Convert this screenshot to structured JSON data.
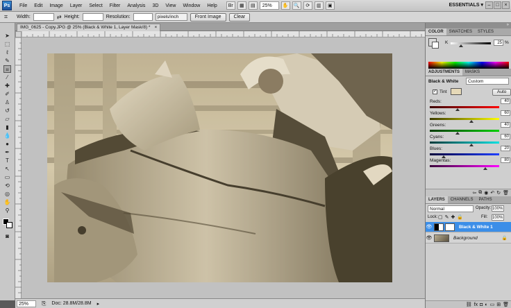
{
  "app": {
    "logo": "Ps"
  },
  "menu": [
    "File",
    "Edit",
    "Image",
    "Layer",
    "Select",
    "Filter",
    "Analysis",
    "3D",
    "View",
    "Window",
    "Help"
  ],
  "menubar": {
    "zoom": "25%",
    "workspace": "ESSENTIALS ▾",
    "window_buttons": [
      "–",
      "□",
      "×"
    ]
  },
  "options": {
    "width_label": "Width:",
    "height_label": "Height:",
    "resolution_label": "Resolution:",
    "unit": "pixels/inch",
    "front_image": "Front Image",
    "clear": "Clear"
  },
  "document": {
    "tab_title": "IMG_0625 - Copy.JPG @ 25% (Black & White 1, Layer Mask/8) *",
    "close": "×"
  },
  "status": {
    "zoom": "25%",
    "doc": "Doc: 28.8M/28.8M"
  },
  "color_panel": {
    "tabs": [
      "COLOR",
      "SWATCHES",
      "STYLES"
    ],
    "k_label": "K",
    "k_value": "25",
    "k_unit": "%",
    "k_fraction": 0.25
  },
  "adjustments": {
    "tabs": [
      "ADJUSTMENTS",
      "MASKS"
    ],
    "title": "Black & White",
    "preset": "Custom",
    "tint_label": "Tint",
    "auto": "Auto",
    "sliders": [
      {
        "label": "Reds:",
        "value": "40",
        "pct": 0.4,
        "colors": [
          "#3a0000",
          "#ff0000"
        ]
      },
      {
        "label": "Yellows:",
        "value": "60",
        "pct": 0.6,
        "colors": [
          "#3a3a00",
          "#ffff00"
        ]
      },
      {
        "label": "Greens:",
        "value": "40",
        "pct": 0.4,
        "colors": [
          "#003a00",
          "#00d000"
        ]
      },
      {
        "label": "Cyans:",
        "value": "60",
        "pct": 0.6,
        "colors": [
          "#003a3a",
          "#00e0e0"
        ]
      },
      {
        "label": "Blues:",
        "value": "20",
        "pct": 0.2,
        "colors": [
          "#00003a",
          "#2040ff"
        ]
      },
      {
        "label": "Magentas:",
        "value": "80",
        "pct": 0.8,
        "colors": [
          "#3a003a",
          "#ff00ff"
        ]
      }
    ]
  },
  "layers": {
    "tabs": [
      "LAYERS",
      "CHANNELS",
      "PATHS"
    ],
    "blend_mode": "Normal",
    "opacity_label": "Opacity:",
    "opacity": "100%",
    "lock_label": "Lock:",
    "fill_label": "Fill:",
    "fill": "100%",
    "items": [
      {
        "name": "Black & White 1",
        "selected": true
      },
      {
        "name": "Background",
        "selected": false
      }
    ]
  },
  "colors": {
    "accent": "#3b8ee8",
    "sepia_light": "#d8cdb0",
    "sepia_dark": "#2e2818"
  }
}
